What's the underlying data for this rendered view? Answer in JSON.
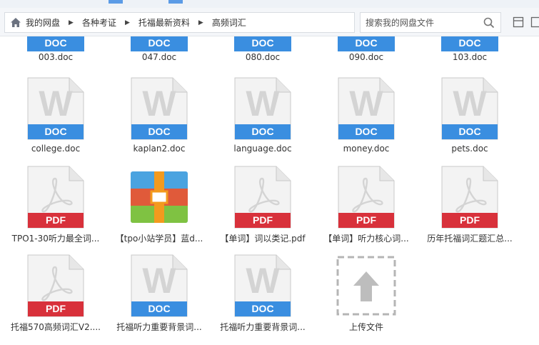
{
  "breadcrumb": {
    "items": [
      {
        "label": "我的网盘"
      },
      {
        "label": "各种考证"
      },
      {
        "label": "托福最新资料"
      },
      {
        "label": "高频词汇"
      }
    ]
  },
  "search": {
    "placeholder": "搜索我的网盘文件"
  },
  "top_row": [
    {
      "name": "003.doc",
      "badge": "DOC"
    },
    {
      "name": "047.doc",
      "badge": "DOC"
    },
    {
      "name": "080.doc",
      "badge": "DOC"
    },
    {
      "name": "090.doc",
      "badge": "DOC"
    },
    {
      "name": "103.doc",
      "badge": "DOC"
    }
  ],
  "rows": [
    [
      {
        "name": "college.doc",
        "type": "doc",
        "badge": "DOC"
      },
      {
        "name": "kaplan2.doc",
        "type": "doc",
        "badge": "DOC"
      },
      {
        "name": "language.doc",
        "type": "doc",
        "badge": "DOC"
      },
      {
        "name": "money.doc",
        "type": "doc",
        "badge": "DOC"
      },
      {
        "name": "pets.doc",
        "type": "doc",
        "badge": "DOC"
      }
    ],
    [
      {
        "name": "TPO1-30听力最全词...",
        "type": "pdf",
        "badge": "PDF"
      },
      {
        "name": "【tpo小站学员】蓝d...",
        "type": "zip",
        "badge": ""
      },
      {
        "name": "【单词】词以类记.pdf",
        "type": "pdf",
        "badge": "PDF"
      },
      {
        "name": "【单词】听力核心词...",
        "type": "pdf",
        "badge": "PDF"
      },
      {
        "name": "历年托福词汇题汇总...",
        "type": "pdf",
        "badge": "PDF"
      }
    ],
    [
      {
        "name": "托福570高频词汇V2....",
        "type": "pdf",
        "badge": "PDF"
      },
      {
        "name": "托福听力重要背景词...",
        "type": "doc",
        "badge": "DOC"
      },
      {
        "name": "托福听力重要背景词...",
        "type": "doc",
        "badge": "DOC"
      },
      {
        "name": "上传文件",
        "type": "upload",
        "badge": ""
      }
    ]
  ],
  "colors": {
    "doc": "#3a8ee0",
    "pdf": "#d8313b",
    "page": "#f3f3f3",
    "glyph": "#d4d4d4"
  }
}
